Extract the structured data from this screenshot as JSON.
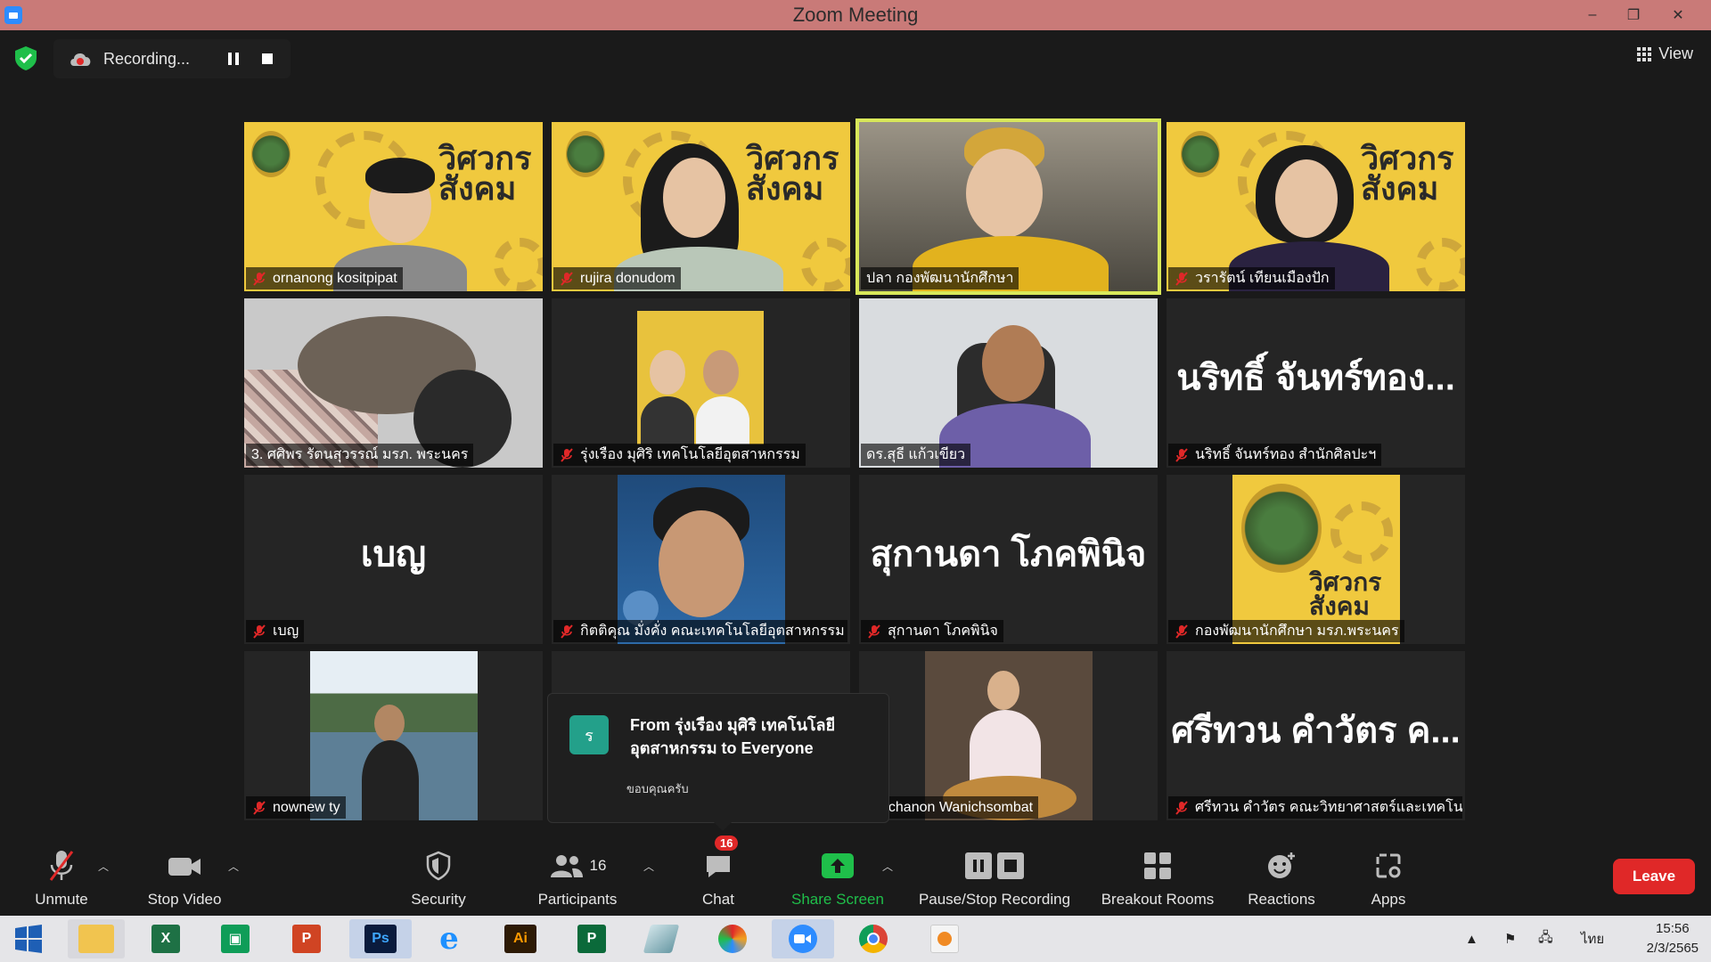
{
  "window": {
    "title": "Zoom Meeting",
    "controls": [
      "–",
      "❐",
      "✕"
    ]
  },
  "recording": {
    "status": "Recording...",
    "view_label": "View"
  },
  "tiles": [
    {
      "name": "ornanong kositpipat",
      "muted": true,
      "type": "video"
    },
    {
      "name": "rujira donudom",
      "muted": true,
      "type": "video"
    },
    {
      "name": "ปลา กองพัฒนานักศึกษา",
      "muted": false,
      "type": "video",
      "active_speaker": true
    },
    {
      "name": "วรารัตน์ เทียนเมืองปัก",
      "muted": true,
      "type": "video"
    },
    {
      "name": "3. ศศิพร รัตนสุวรรณ์ มรภ. พระนคร",
      "muted": false,
      "type": "video"
    },
    {
      "name": "รุ่งเรือง มุศิริ เทคโนโลยีอุตสาหกรรม",
      "muted": true,
      "type": "video"
    },
    {
      "name": "ดร.สุธี แก้วเขียว",
      "muted": false,
      "type": "video"
    },
    {
      "name": "นริทธิ์ จันทร์ทอง สำนักศิลปะฯ",
      "muted": true,
      "type": "name",
      "display": "นริทธิ์ จันทร์ทอง..."
    },
    {
      "name": "เบญ",
      "muted": true,
      "type": "name",
      "display": "เบญ"
    },
    {
      "name": "กิตติคุณ มั่งคั่ง คณะเทคโนโลยีอุตสาหกรรม",
      "muted": true,
      "type": "picture"
    },
    {
      "name": "สุกานดา โภคพินิจ",
      "muted": true,
      "type": "name",
      "display": "สุกานดา โภคพินิจ"
    },
    {
      "name": "กองพัฒนานักศึกษา มรภ.พระนคร",
      "muted": true,
      "type": "picture"
    },
    {
      "name": "nownew ty",
      "muted": true,
      "type": "picture"
    },
    {
      "name": "",
      "muted": false,
      "type": "blank"
    },
    {
      "name": "Ratchanon Wanichsombat",
      "muted": false,
      "type": "picture"
    },
    {
      "name": "ศรีทวน คำวัตร คณะวิทยาศาสตร์และเทคโน",
      "muted": true,
      "type": "name",
      "display": "ศรีทวน คำวัตร ค..."
    }
  ],
  "brand": {
    "line1": "วิศวกร",
    "line2": "สังคม"
  },
  "chat_popup": {
    "avatar_letter": "ร",
    "from": "From รุ่งเรือง มุศิริ เทคโนโลยีอุตสาหกรรม to Everyone",
    "message": "ขอบคุณครับ"
  },
  "toolbar": {
    "unmute": "Unmute",
    "stop_video": "Stop Video",
    "security": "Security",
    "participants": "Participants",
    "participants_count": "16",
    "chat": "Chat",
    "chat_badge": "16",
    "share_screen": "Share Screen",
    "pause_stop_recording": "Pause/Stop Recording",
    "breakout_rooms": "Breakout Rooms",
    "reactions": "Reactions",
    "apps": "Apps",
    "leave": "Leave"
  },
  "taskbar": {
    "apps": [
      "File Explorer",
      "Excel",
      "Publisher",
      "PowerPoint",
      "Photoshop",
      "Internet Explorer",
      "Illustrator",
      "Project",
      "Tool",
      "PhotoScape",
      "Zoom",
      "Chrome",
      "PhotoScape Viewer"
    ],
    "app_letters": {
      "excel": "X",
      "publisher": "",
      "powerpoint": "P",
      "photoshop": "Ps",
      "illustrator": "Ai",
      "project": "P",
      "ie": "e"
    },
    "language": "ไทย",
    "time": "15:56",
    "date": "2/3/2565"
  },
  "colors": {
    "titlebar": "#c97a78",
    "active_speaker": "#d9e85a",
    "leave": "#e02828",
    "share": "#1fbf4a",
    "security_shield": "#1fbf4a"
  }
}
